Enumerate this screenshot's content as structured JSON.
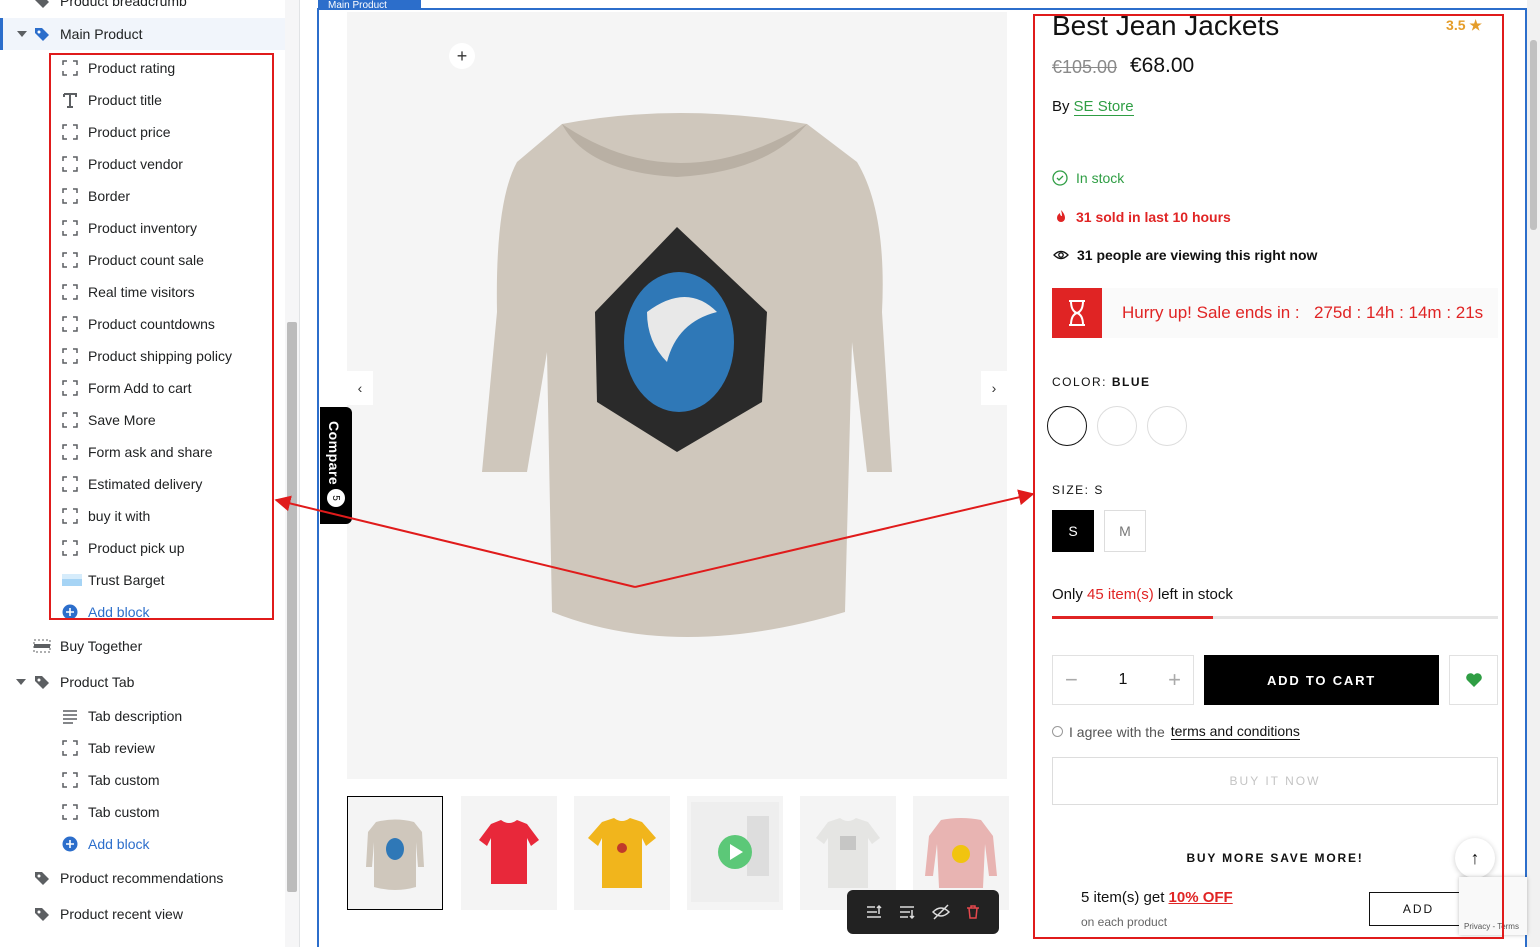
{
  "sidebar": {
    "top_item": "Product breadcrumb",
    "main_section": "Main Product",
    "blocks": [
      {
        "label": "Product rating",
        "icon": "block-icon"
      },
      {
        "label": "Product title",
        "icon": "text-icon"
      },
      {
        "label": "Product price",
        "icon": "block-icon"
      },
      {
        "label": "Product vendor",
        "icon": "block-icon"
      },
      {
        "label": "Border",
        "icon": "block-icon"
      },
      {
        "label": "Product inventory",
        "icon": "block-icon"
      },
      {
        "label": "Product count sale",
        "icon": "block-icon"
      },
      {
        "label": "Real time visitors",
        "icon": "block-icon"
      },
      {
        "label": "Product countdowns",
        "icon": "block-icon"
      },
      {
        "label": "Product shipping policy",
        "icon": "block-icon"
      },
      {
        "label": "Form Add to cart",
        "icon": "block-icon"
      },
      {
        "label": "Save More",
        "icon": "block-icon"
      },
      {
        "label": "Form ask and share",
        "icon": "block-icon"
      },
      {
        "label": "Estimated delivery",
        "icon": "block-icon"
      },
      {
        "label": "buy it with",
        "icon": "block-icon"
      },
      {
        "label": "Product pick up",
        "icon": "block-icon"
      },
      {
        "label": "Trust Barget",
        "icon": "image-icon"
      }
    ],
    "add_block": "Add block",
    "buy_together": "Buy Together",
    "product_tab": "Product Tab",
    "tab_blocks": [
      {
        "label": "Tab description",
        "icon": "lines-icon"
      },
      {
        "label": "Tab review",
        "icon": "block-icon"
      },
      {
        "label": "Tab custom",
        "icon": "block-icon"
      },
      {
        "label": "Tab custom",
        "icon": "block-icon"
      }
    ],
    "tab_add_block": "Add block",
    "product_recommendations": "Product recommendations",
    "product_recent_view": "Product recent view"
  },
  "preview": {
    "frame_label": "Main Product",
    "compare_label": "Compare",
    "compare_count": "5",
    "colors": {
      "accent": "#2c6ecb",
      "sale": "#e02424",
      "stock": "#2f9e44",
      "annotation": "#e01b1b"
    }
  },
  "product": {
    "title": "Best Jean Jackets",
    "rating": "3.5 ★",
    "old_price": "€105.00",
    "price": "€68.00",
    "by_label": "By",
    "vendor": "SE Store",
    "in_stock": "In stock",
    "sold": "31 sold in last 10 hours",
    "viewing": "31 people are viewing this right now",
    "sale_label": "Hurry up! Sale ends in :",
    "sale_time": "275d : 14h : 14m : 21s",
    "color_label": "COLOR:",
    "color_value": "BLUE",
    "size_label": "SIZE:",
    "size_value": "S",
    "sizes": [
      "S",
      "M"
    ],
    "only_prefix": "Only",
    "only_count": "45 item(s)",
    "only_suffix": "left in stock",
    "stock_level": 0.36,
    "quantity": "1",
    "add_to_cart": "ADD TO CART",
    "agree_prefix": "I agree with the",
    "agree_link": "terms and conditions",
    "buy_now": "BUY IT NOW",
    "bms_title": "BUY MORE SAVE MORE!",
    "bms_item_prefix": "5 item(s) get",
    "bms_item_off": "10% OFF",
    "bms_sub": "on each product",
    "bms_add": "ADD",
    "recaptcha": "Privacy - Terms"
  }
}
